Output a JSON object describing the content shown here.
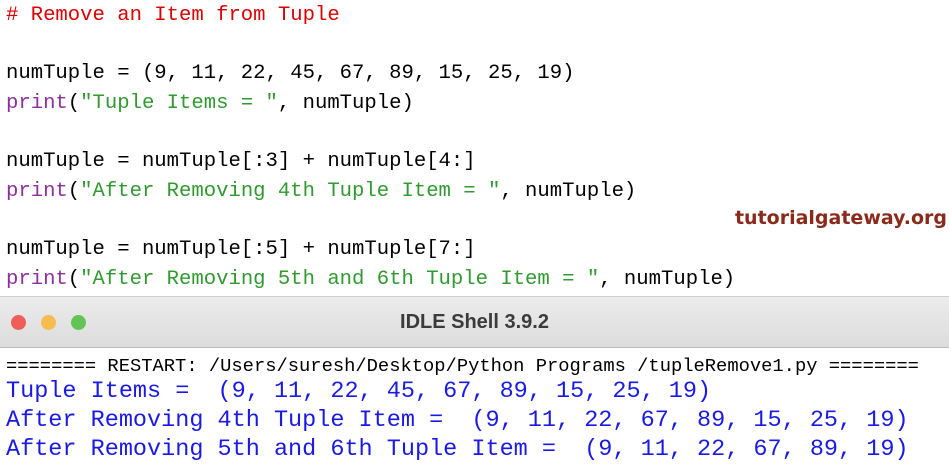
{
  "editor": {
    "comment": "# Remove an Item from Tuple",
    "line1": "numTuple = (9, 11, 22, 45, 67, 89, 15, 25, 19)",
    "line2": {
      "kw": "print",
      "p1": "(",
      "str": "\"Tuple Items = \"",
      "rest": ", numTuple)"
    },
    "line3": "numTuple = numTuple[:3] + numTuple[4:]",
    "line4": {
      "kw": "print",
      "p1": "(",
      "str": "\"After Removing 4th Tuple Item = \"",
      "rest": ", numTuple)"
    },
    "line5": "numTuple = numTuple[:5] + numTuple[7:]",
    "line6": {
      "kw": "print",
      "p1": "(",
      "str": "\"After Removing 5th and 6th Tuple Item = \"",
      "rest": ", numTuple)"
    }
  },
  "watermark": "tutorialgateway.org",
  "shell": {
    "title": "IDLE Shell 3.9.2",
    "restart": "======== RESTART: /Users/suresh/Desktop/Python Programs /tupleRemove1.py ========",
    "output": [
      "Tuple Items =  (9, 11, 22, 45, 67, 89, 15, 25, 19)",
      "After Removing 4th Tuple Item =  (9, 11, 22, 67, 89, 15, 25, 19)",
      "After Removing 5th and 6th Tuple Item =  (9, 11, 22, 67, 89, 19)"
    ]
  },
  "colors": {
    "close": "#ee5f57",
    "minimize": "#f5bd4f",
    "zoom": "#61c454"
  }
}
